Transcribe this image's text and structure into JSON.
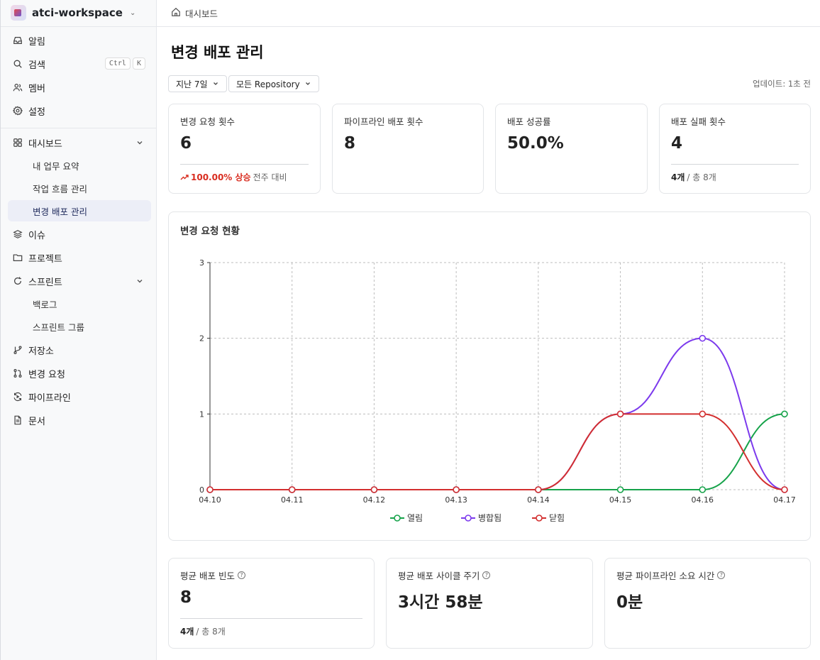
{
  "workspace": {
    "name": "atci-workspace"
  },
  "sidebar": {
    "top": [
      {
        "label": "알림",
        "icon": "inbox-icon"
      },
      {
        "label": "검색",
        "icon": "search-icon",
        "kbd": [
          "Ctrl",
          "K"
        ]
      },
      {
        "label": "멤버",
        "icon": "users-icon"
      },
      {
        "label": "설정",
        "icon": "gear-icon"
      }
    ],
    "dashboard": {
      "label": "대시보드",
      "subs": [
        "내 업무 요약",
        "작업 흐름 관리",
        "변경 배포 관리"
      ]
    },
    "issues": "이슈",
    "projects": "프로젝트",
    "sprint": {
      "label": "스프린트",
      "subs": [
        "백로그",
        "스프린트 그룹"
      ]
    },
    "bottom": [
      "저장소",
      "변경 요청",
      "파이프라인",
      "문서"
    ]
  },
  "breadcrumb": "대시보드",
  "page_title": "변경 배포 관리",
  "filters": {
    "period": "지난 7일",
    "repo": "모든 Repository"
  },
  "updated": "업데이트: 1초 전",
  "stats": [
    {
      "label": "변경 요청 횟수",
      "value": "6",
      "trend": "100.00% 상승",
      "trend_note": "전주 대비"
    },
    {
      "label": "파이프라인 배포 횟수",
      "value": "8"
    },
    {
      "label": "배포 성공률",
      "value": "50.0%"
    },
    {
      "label": "배포 실패 횟수",
      "value": "4",
      "foot_strong": "4개",
      "foot_rest": "/ 총 8개"
    }
  ],
  "chart_title": "변경 요청 현황",
  "chart_data": {
    "type": "line",
    "x": [
      "04.10",
      "04.11",
      "04.12",
      "04.13",
      "04.14",
      "04.15",
      "04.16",
      "04.17"
    ],
    "ylim": [
      0,
      3
    ],
    "yticks": [
      0,
      1,
      2,
      3
    ],
    "grid": true,
    "legend_position": "bottom",
    "series": [
      {
        "name": "열림",
        "color": "#16a34a",
        "values": [
          0,
          0,
          0,
          0,
          0,
          0,
          0,
          1
        ]
      },
      {
        "name": "병합됨",
        "color": "#7c3aed",
        "values": [
          0,
          0,
          0,
          0,
          0,
          1,
          2,
          0
        ]
      },
      {
        "name": "닫힘",
        "color": "#d32f2f",
        "values": [
          0,
          0,
          0,
          0,
          0,
          1,
          1,
          0
        ]
      }
    ]
  },
  "bottom_stats": [
    {
      "label": "평균 배포 빈도",
      "value": "8",
      "foot_strong": "4개",
      "foot_rest": "/ 총 8개"
    },
    {
      "label": "평균 배포 사이클 주기",
      "value": "3시간 58분"
    },
    {
      "label": "평균 파이프라인 소요 시간",
      "value": "0분"
    }
  ]
}
